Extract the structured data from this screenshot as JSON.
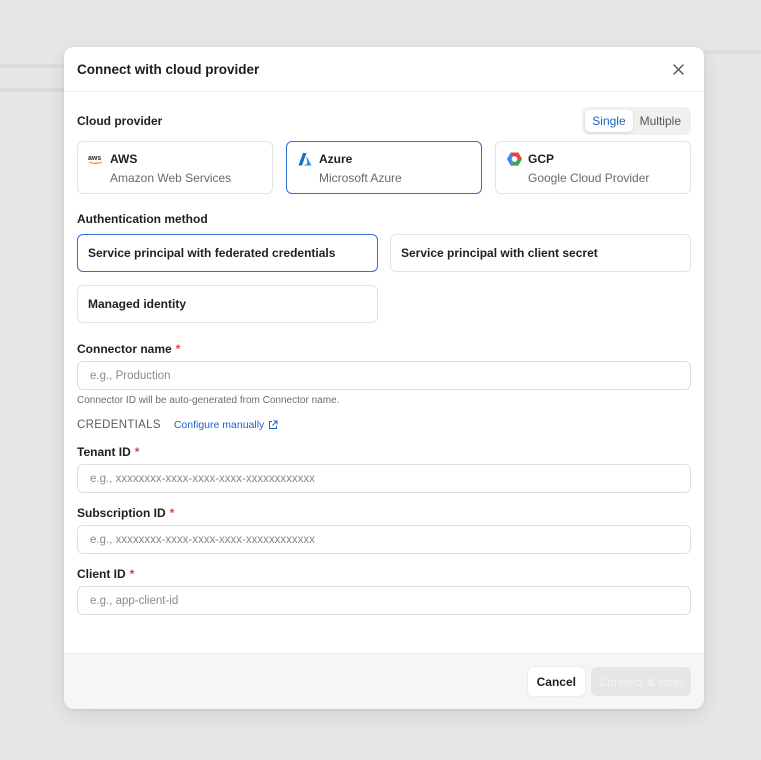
{
  "modal": {
    "title": "Connect with cloud provider",
    "close_icon": "close-icon"
  },
  "cloud_provider": {
    "label": "Cloud provider",
    "mode_options": [
      "Single",
      "Multiple"
    ],
    "selected_mode": "Single",
    "providers": [
      {
        "name": "AWS",
        "subtitle": "Amazon Web Services",
        "icon": "aws-logo-icon",
        "selected": false
      },
      {
        "name": "Azure",
        "subtitle": "Microsoft Azure",
        "icon": "azure-logo-icon",
        "selected": true
      },
      {
        "name": "GCP",
        "subtitle": "Google Cloud Provider",
        "icon": "gcp-logo-icon",
        "selected": false
      }
    ]
  },
  "auth": {
    "label": "Authentication method",
    "options": [
      {
        "label": "Service principal with federated credentials",
        "selected": true
      },
      {
        "label": "Service principal with client secret",
        "selected": false
      },
      {
        "label": "Managed identity",
        "selected": false
      }
    ]
  },
  "connector": {
    "label": "Connector name",
    "required_mark": "*",
    "placeholder": "e.g., Production",
    "value": "",
    "helper": "Connector ID will be auto-generated from Connector name."
  },
  "credentials": {
    "title": "CREDENTIALS",
    "configure_link": "Configure manually",
    "fields": [
      {
        "label": "Tenant ID",
        "required_mark": "*",
        "placeholder": "e.g., xxxxxxxx-xxxx-xxxx-xxxx-xxxxxxxxxxxx",
        "value": ""
      },
      {
        "label": "Subscription ID",
        "required_mark": "*",
        "placeholder": "e.g., xxxxxxxx-xxxx-xxxx-xxxx-xxxxxxxxxxxx",
        "value": ""
      },
      {
        "label": "Client ID",
        "required_mark": "*",
        "placeholder": "e.g., app-client-id",
        "value": ""
      }
    ]
  },
  "footer": {
    "cancel_label": "Cancel",
    "primary_label": "Connect & scan",
    "primary_disabled": true
  },
  "colors": {
    "accent": "#2f6fd0",
    "link": "#1d63c9",
    "required": "#e0413a",
    "disabled_button": "#e6e6e6"
  }
}
